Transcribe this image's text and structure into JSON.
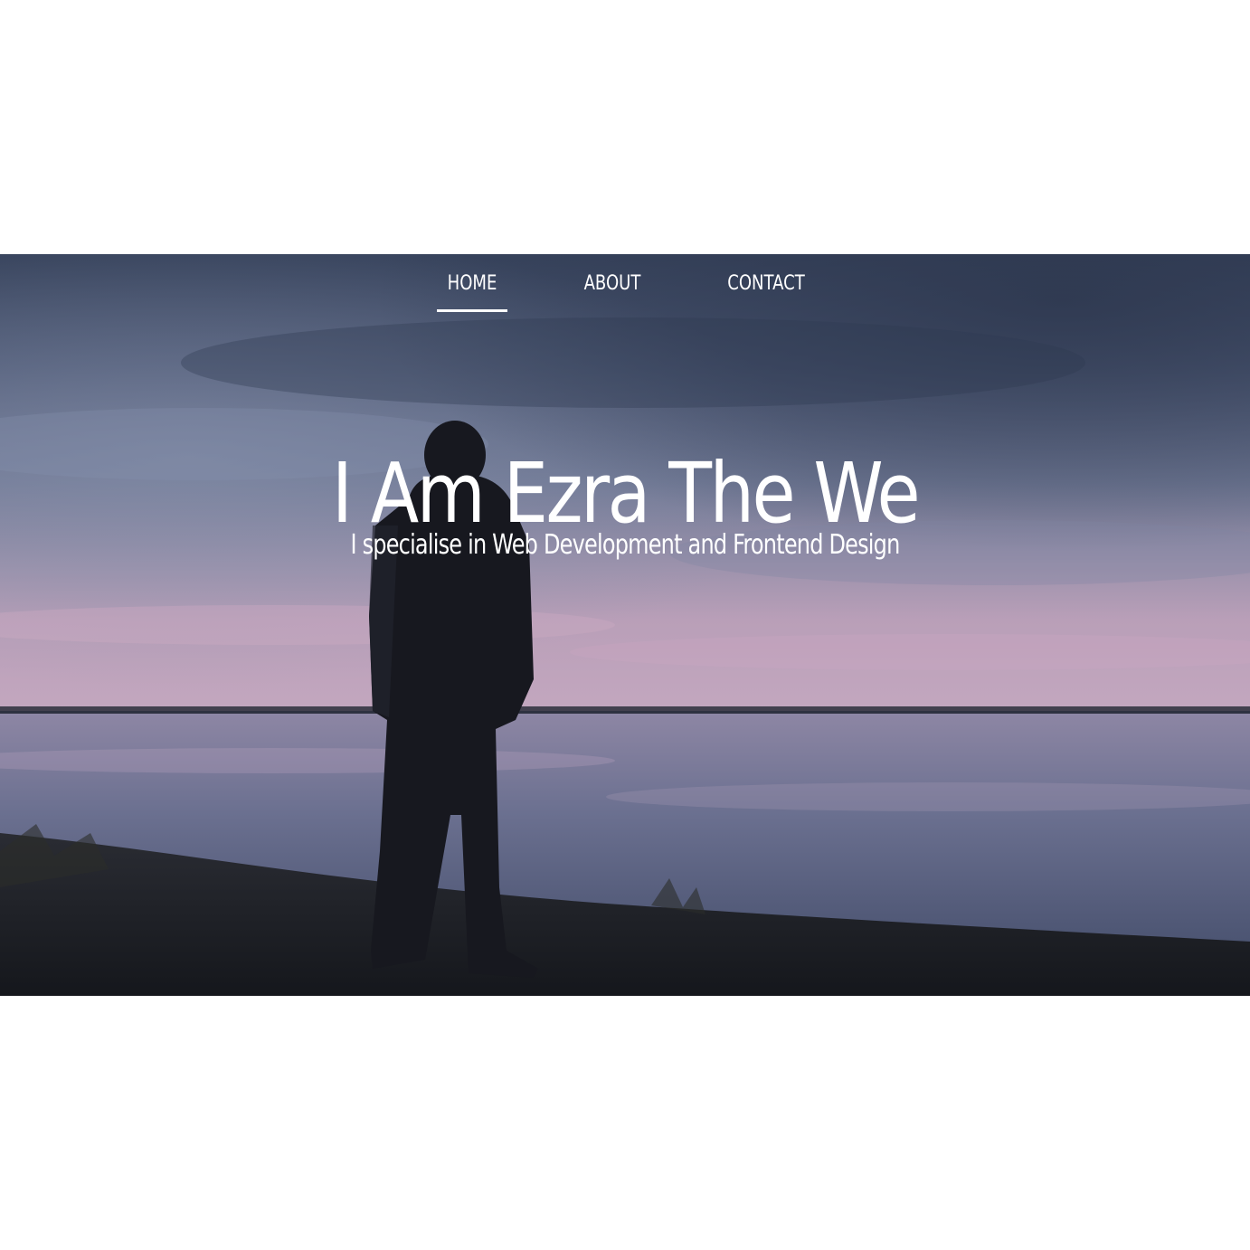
{
  "nav": {
    "items": [
      {
        "label": "HOME",
        "active": true
      },
      {
        "label": "ABOUT",
        "active": false
      },
      {
        "label": "CONTACT",
        "active": false
      }
    ]
  },
  "hero": {
    "title": "I Am Ezra The We",
    "subtitle": "I specialise in Web Development and Frontend Design",
    "background": "lake-dusk-person-silhouette",
    "colors": {
      "sky_top": "#3b475f",
      "sky_mid": "#6b7591",
      "horizon_pink": "#b79cb4",
      "water": "#5a6582",
      "ground": "#1c1f26",
      "text": "#ffffff"
    }
  }
}
